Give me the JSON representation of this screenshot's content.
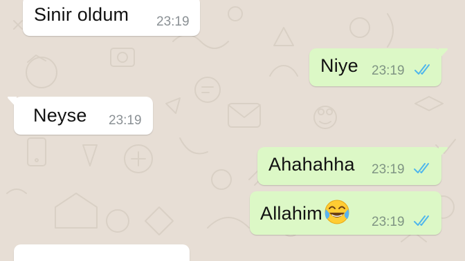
{
  "chat": {
    "messages": [
      {
        "direction": "incoming",
        "text": "Sinir oldum",
        "time": "23:19"
      },
      {
        "direction": "outgoing",
        "text": "Niye",
        "time": "23:19",
        "status": "read"
      },
      {
        "direction": "incoming",
        "text": "Neyse",
        "time": "23:19"
      },
      {
        "direction": "outgoing",
        "text": "Ahahahha",
        "time": "23:19",
        "status": "read"
      },
      {
        "direction": "outgoing",
        "text": "Allahim",
        "emoji": "face-with-tears-of-joy",
        "time": "23:19",
        "status": "read"
      }
    ]
  },
  "colors": {
    "wallpaper": "#e7ded5",
    "incoming_bubble": "#ffffff",
    "outgoing_bubble": "#dcf8c6",
    "read_ticks": "#4fb6ec",
    "timestamp": "#8a9094"
  }
}
